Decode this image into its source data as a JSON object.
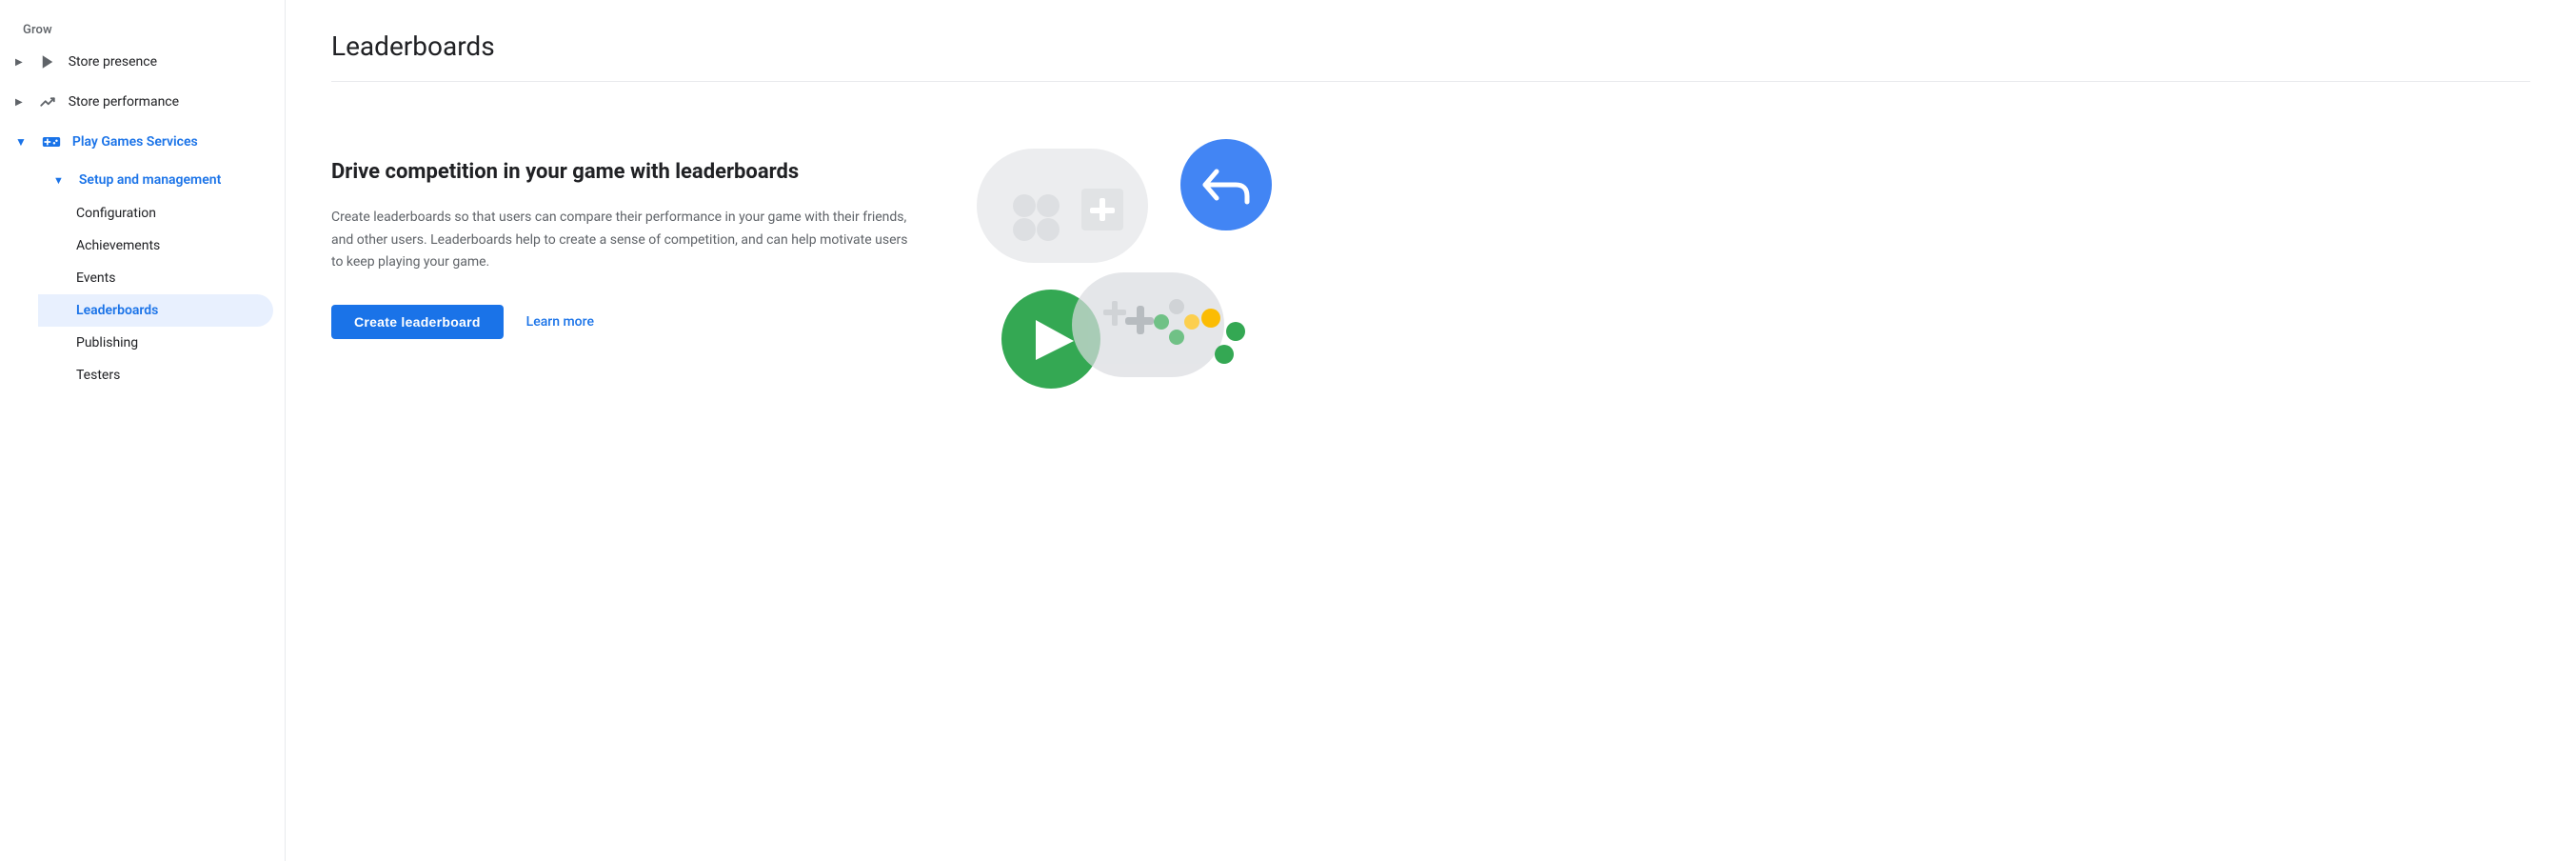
{
  "sidebar": {
    "grow_label": "Grow",
    "items": [
      {
        "id": "store-presence",
        "label": "Store presence",
        "icon": "play-icon",
        "expanded": false,
        "active": false,
        "hasExpand": true
      },
      {
        "id": "store-performance",
        "label": "Store performance",
        "icon": "trending-up-icon",
        "expanded": false,
        "active": false,
        "hasExpand": true
      },
      {
        "id": "play-games-services",
        "label": "Play Games Services",
        "icon": "gamepad-icon",
        "expanded": true,
        "active": true,
        "hasExpand": true
      }
    ],
    "sub_sections": [
      {
        "id": "setup-and-management",
        "label": "Setup and management",
        "expanded": true,
        "active": true
      }
    ],
    "sub_items": [
      {
        "id": "configuration",
        "label": "Configuration",
        "active": false
      },
      {
        "id": "achievements",
        "label": "Achievements",
        "active": false
      },
      {
        "id": "events",
        "label": "Events",
        "active": false
      },
      {
        "id": "leaderboards",
        "label": "Leaderboards",
        "active": true
      },
      {
        "id": "publishing",
        "label": "Publishing",
        "active": false
      },
      {
        "id": "testers",
        "label": "Testers",
        "active": false
      }
    ]
  },
  "main": {
    "page_title": "Leaderboards",
    "feature_title": "Drive competition in your game with leaderboards",
    "feature_description": "Create leaderboards so that users can compare their performance in your game with their friends, and other users. Leaderboards help to create a sense of competition, and can help motivate users to keep playing your game.",
    "create_button_label": "Create leaderboard",
    "learn_more_label": "Learn more"
  },
  "colors": {
    "primary": "#1a73e8",
    "active_bg": "#e8f0fe",
    "text_primary": "#202124",
    "text_secondary": "#5f6368",
    "divider": "#e8eaed",
    "illustration_gray": "#dadce0",
    "illustration_blue": "#4285f4",
    "illustration_green": "#34a853",
    "illustration_yellow": "#fbbc04",
    "illustration_dark_gray": "#bdc1c6"
  }
}
